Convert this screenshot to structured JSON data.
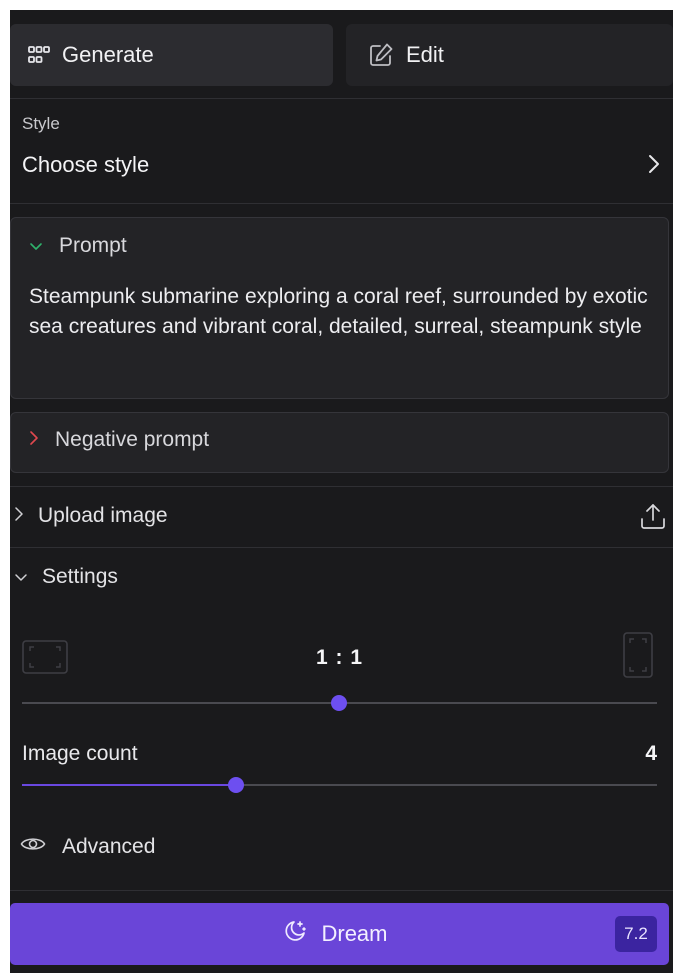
{
  "tabs": {
    "generate": {
      "label": "Generate",
      "icon": "grid-icon",
      "active": true
    },
    "edit": {
      "label": "Edit",
      "icon": "pencil-square-icon",
      "active": false
    }
  },
  "style": {
    "label": "Style",
    "value": "Choose style",
    "icon": "chevron-right-icon"
  },
  "prompt": {
    "header": "Prompt",
    "expanded": true,
    "text": "Steampunk submarine exploring a coral reef, surrounded by exotic sea creatures and vibrant coral, detailed, surreal, steampunk style",
    "chevron_color": "#2fb36b"
  },
  "negative_prompt": {
    "header": "Negative prompt",
    "expanded": false,
    "chevron_color": "#e0484f"
  },
  "upload": {
    "label": "Upload image",
    "icon": "upload-icon"
  },
  "settings": {
    "label": "Settings",
    "expanded": true,
    "aspect_ratio": {
      "value": "1:1",
      "slider_fraction": 0.5
    },
    "image_count": {
      "label": "Image count",
      "value": "4",
      "slider_fraction": 0.34
    },
    "advanced_label": "Advanced"
  },
  "dream": {
    "label": "Dream",
    "cost": "7.2",
    "icon": "moon-stars-icon"
  },
  "colors": {
    "accent": "#6a45d8",
    "panel_bg": "#1a1a1c",
    "card_bg": "#232326"
  }
}
